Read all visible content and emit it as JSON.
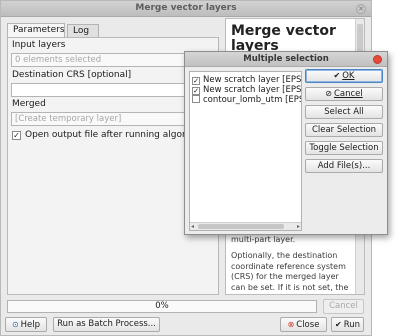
{
  "window": {
    "title": "Merge vector layers"
  },
  "tabs": [
    "Parameters",
    "Log"
  ],
  "params": {
    "input_layers_label": "Input layers",
    "input_layers_value": "0 elements selected",
    "dest_crs_label": "Destination CRS [optional]",
    "dest_crs_value": "",
    "merged_label": "Merged",
    "merged_placeholder": "[Create temporary layer]",
    "open_output_label": "Open output file after running algorithm",
    "open_output_checked": true
  },
  "help": {
    "title": "Merge vector layers",
    "p1": "multi-part layer.",
    "p2": "Optionally, the destination coordinate reference system (CRS) for the merged layer can be set. If it is not set, the"
  },
  "progress": {
    "text": "0%",
    "value": 0
  },
  "buttons": {
    "cancel": "Cancel",
    "help": "Help",
    "batch": "Run as Batch Process...",
    "close": "Close",
    "run": "Run"
  },
  "dialog": {
    "title": "Multiple selection",
    "items": [
      {
        "label": "New scratch layer [EPSG",
        "checked": true
      },
      {
        "label": "New scratch layer [EPSG",
        "checked": true
      },
      {
        "label": "contour_lomb_utm [EPS",
        "checked": false
      }
    ],
    "buttons": {
      "ok": "OK",
      "cancel": "Cancel",
      "select_all": "Select All",
      "clear_selection": "Clear Selection",
      "toggle_selection": "Toggle Selection",
      "add_files": "Add File(s)..."
    }
  },
  "icons": {
    "help": "help-icon",
    "close": "close-circle-icon",
    "run": "checkmark-icon",
    "ok": "checkmark-icon",
    "cancel": "cancel-circle-icon"
  },
  "colors": {
    "close_icon": "#d23a2a",
    "dialog_close": "#e74a3a",
    "default_button_border": "#4a86c7"
  }
}
